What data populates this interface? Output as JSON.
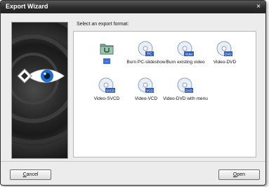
{
  "window": {
    "title": "Export Wizard",
    "close_glyph": "×"
  },
  "main": {
    "prompt": "Select an export format:"
  },
  "formats": [
    {
      "label": "...",
      "icon": "folder-icon",
      "selected": true
    },
    {
      "label": "Burn PC-slideshow",
      "icon": "disc-pc-icon",
      "badge": "PC"
    },
    {
      "label": "Burn existing video",
      "icon": "disc-video-icon",
      "badge": "Video"
    },
    {
      "label": "Video-DVD",
      "icon": "disc-dvd-icon",
      "badge": "DVD"
    },
    {
      "label": "Video-SVCD",
      "icon": "disc-svcd-icon",
      "badge": "SVCD"
    },
    {
      "label": "Video-VCD",
      "icon": "disc-vcd-icon",
      "badge": "VCD"
    },
    {
      "label": "Video-DVD with menu",
      "icon": "disc-dvd-menu-icon",
      "badge": "DVD"
    }
  ],
  "buttons": {
    "cancel_first": "C",
    "cancel_rest": "ancel",
    "open_first": "O",
    "open_rest": "pen"
  },
  "colors": {
    "selection": "#3f6fd4",
    "titlebar": "#2c2c2c"
  }
}
